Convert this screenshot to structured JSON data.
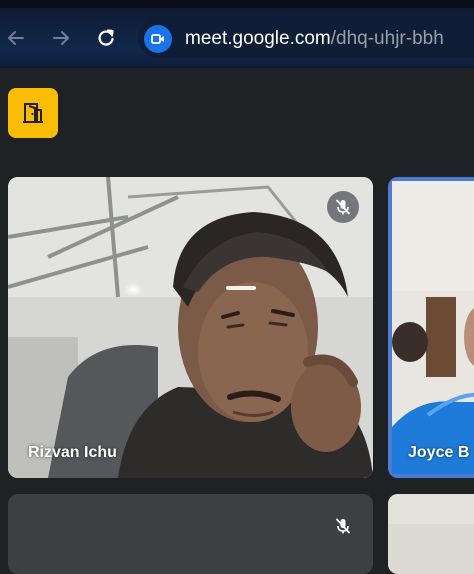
{
  "browser": {
    "url_host": "meet.google.com",
    "url_path": "/dhq-uhjr-bbh",
    "icons": [
      "back-arrow-icon",
      "forward-arrow-icon",
      "reload-icon",
      "meet-camera-icon"
    ]
  },
  "meet": {
    "activity_icon": "door-icon",
    "accent_color": "#fbbc04",
    "participants": [
      {
        "name": "Rizvan Ichu",
        "muted": true
      },
      {
        "name": "Joyce B",
        "muted": false,
        "active_speaker": true
      },
      {
        "name": "",
        "muted": true
      },
      {
        "name": "",
        "muted": false
      }
    ]
  }
}
